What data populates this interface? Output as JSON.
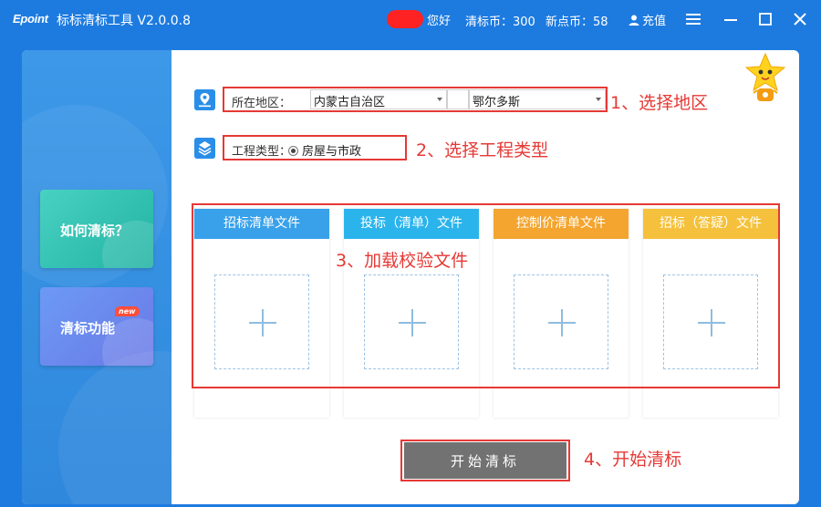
{
  "titlebar": {
    "logo": "Epoint",
    "title": "标标清标工具 V2.0.0.8",
    "greeting": "您好",
    "coins_1": "清标币：300",
    "coins_2": "新点币：58",
    "recharge": "充值",
    "icons": [
      "user-icon",
      "menu-icon",
      "minimize-icon",
      "maximize-icon",
      "close-icon"
    ]
  },
  "sidebar": {
    "how_label": "如何清标？",
    "func_label": "清标功能",
    "new_badge": "new"
  },
  "form": {
    "region_label": "所在地区：",
    "province": "内蒙古自治区",
    "city": "鄂尔多斯",
    "project_type_label": "工程类型：",
    "project_type_option": "房屋与市政"
  },
  "file_cards": [
    {
      "title": "招标清单文件",
      "color": "#39a1ea"
    },
    {
      "title": "投标（清单）文件",
      "color": "#2bb4ec"
    },
    {
      "title": "控制价清单文件",
      "color": "#f3a52f"
    },
    {
      "title": "招标（答疑）文件",
      "color": "#f5c13c"
    }
  ],
  "start_button": "开始清标",
  "annotations": {
    "step1": "1、选择地区",
    "step2": "2、选择工程类型",
    "step3": "3、加载校验文件",
    "step4": "4、开始清标"
  },
  "colors": {
    "titlebar": "#1d7be0",
    "annotation_red": "#e53935",
    "button_gray": "#727272"
  }
}
